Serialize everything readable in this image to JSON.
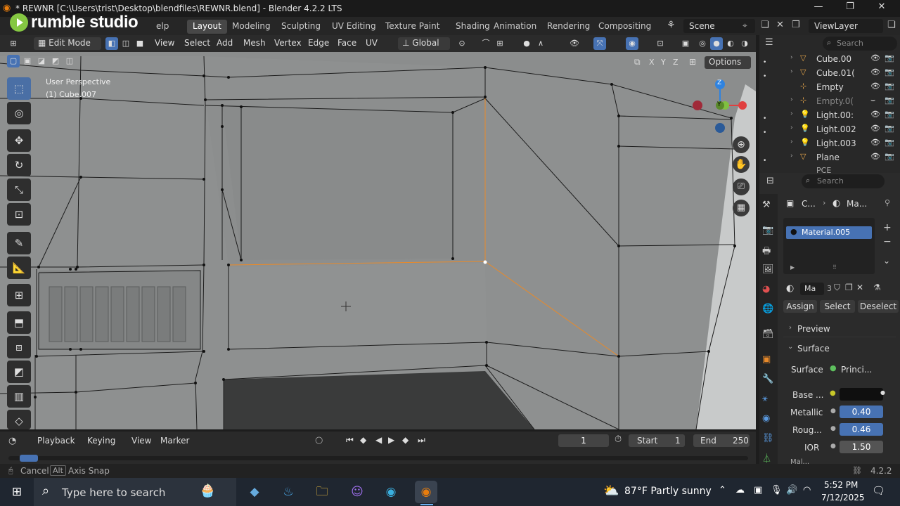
{
  "window": {
    "title": "* REWNR [C:\\Users\\trist\\Desktop\\blendfiles\\REWNR.blend] - Blender 4.2.2 LTS",
    "min": "—",
    "max": "❐",
    "close": "✕"
  },
  "watermark": {
    "text": "rumble studio"
  },
  "menus": {
    "help": "elp"
  },
  "workspaces": [
    "Layout",
    "Modeling",
    "Sculpting",
    "UV Editing",
    "Texture Paint",
    "Shading",
    "Animation",
    "Rendering",
    "Compositing"
  ],
  "scene": {
    "label": "Scene",
    "viewlayer": "ViewLayer"
  },
  "header": {
    "mode": "Edit Mode",
    "items": [
      "View",
      "Select",
      "Add",
      "Mesh",
      "Vertex",
      "Edge",
      "Face",
      "UV"
    ],
    "orientation": "Global",
    "options": "Options",
    "axes": [
      "X",
      "Y",
      "Z"
    ]
  },
  "viewport": {
    "overlay_line1": "User Perspective",
    "overlay_line2": "(1) Cube.007",
    "gizmo": {
      "z": "Z",
      "y": "Y"
    }
  },
  "outliner": {
    "search_placeholder": "Search",
    "rows": [
      {
        "label": "Cube.00",
        "icon": "▽",
        "iconColor": "#e8a64a"
      },
      {
        "label": "Cube.01(",
        "icon": "▽",
        "iconColor": "#e8a64a"
      },
      {
        "label": "Empty",
        "icon": "⊹",
        "iconColor": "#e8a64a"
      },
      {
        "label": "Empty.0(",
        "icon": "⊹",
        "iconColor": "#e8a64a",
        "dim": true
      },
      {
        "label": "Light.00:",
        "icon": "💡",
        "iconColor": "#e8a64a"
      },
      {
        "label": "Light.002",
        "icon": "💡",
        "iconColor": "#e8a64a"
      },
      {
        "label": "Light.003",
        "icon": "💡",
        "iconColor": "#e8a64a"
      },
      {
        "label": "Plane",
        "icon": "▽",
        "iconColor": "#e8a64a"
      }
    ],
    "partial": "PCE"
  },
  "properties": {
    "search_placeholder": "Search",
    "breadcrumb_obj": "C...",
    "breadcrumb_mat": "Ma...",
    "material_slot": "Material.005",
    "mat_name": "Ma",
    "users": "3",
    "assign": "Assign",
    "select": "Select",
    "deselect": "Deselect",
    "preview": "Preview",
    "surface": "Surface",
    "surface_label": "Surface",
    "surface_value": "Princi...",
    "base": "Base ...",
    "metallic_label": "Metallic",
    "metallic": "0.40",
    "rough_label": "Roug...",
    "rough": "0.46",
    "ior_label": "IOR",
    "ior": "1.50",
    "cut": "Mal..."
  },
  "timeline": {
    "playback": "Playback",
    "keying": "Keying",
    "view": "View",
    "marker": "Marker",
    "frame": "1",
    "start_label": "Start",
    "start": "1",
    "end_label": "End",
    "end": "250"
  },
  "status": {
    "cancel": "Cancel",
    "alt": "Alt",
    "axis_snap": "Axis Snap",
    "version": "4.2.2"
  },
  "taskbar": {
    "search": "Type here to search",
    "weather": "87°F  Partly sunny",
    "time": "5:52 PM",
    "date": "7/12/2025"
  }
}
